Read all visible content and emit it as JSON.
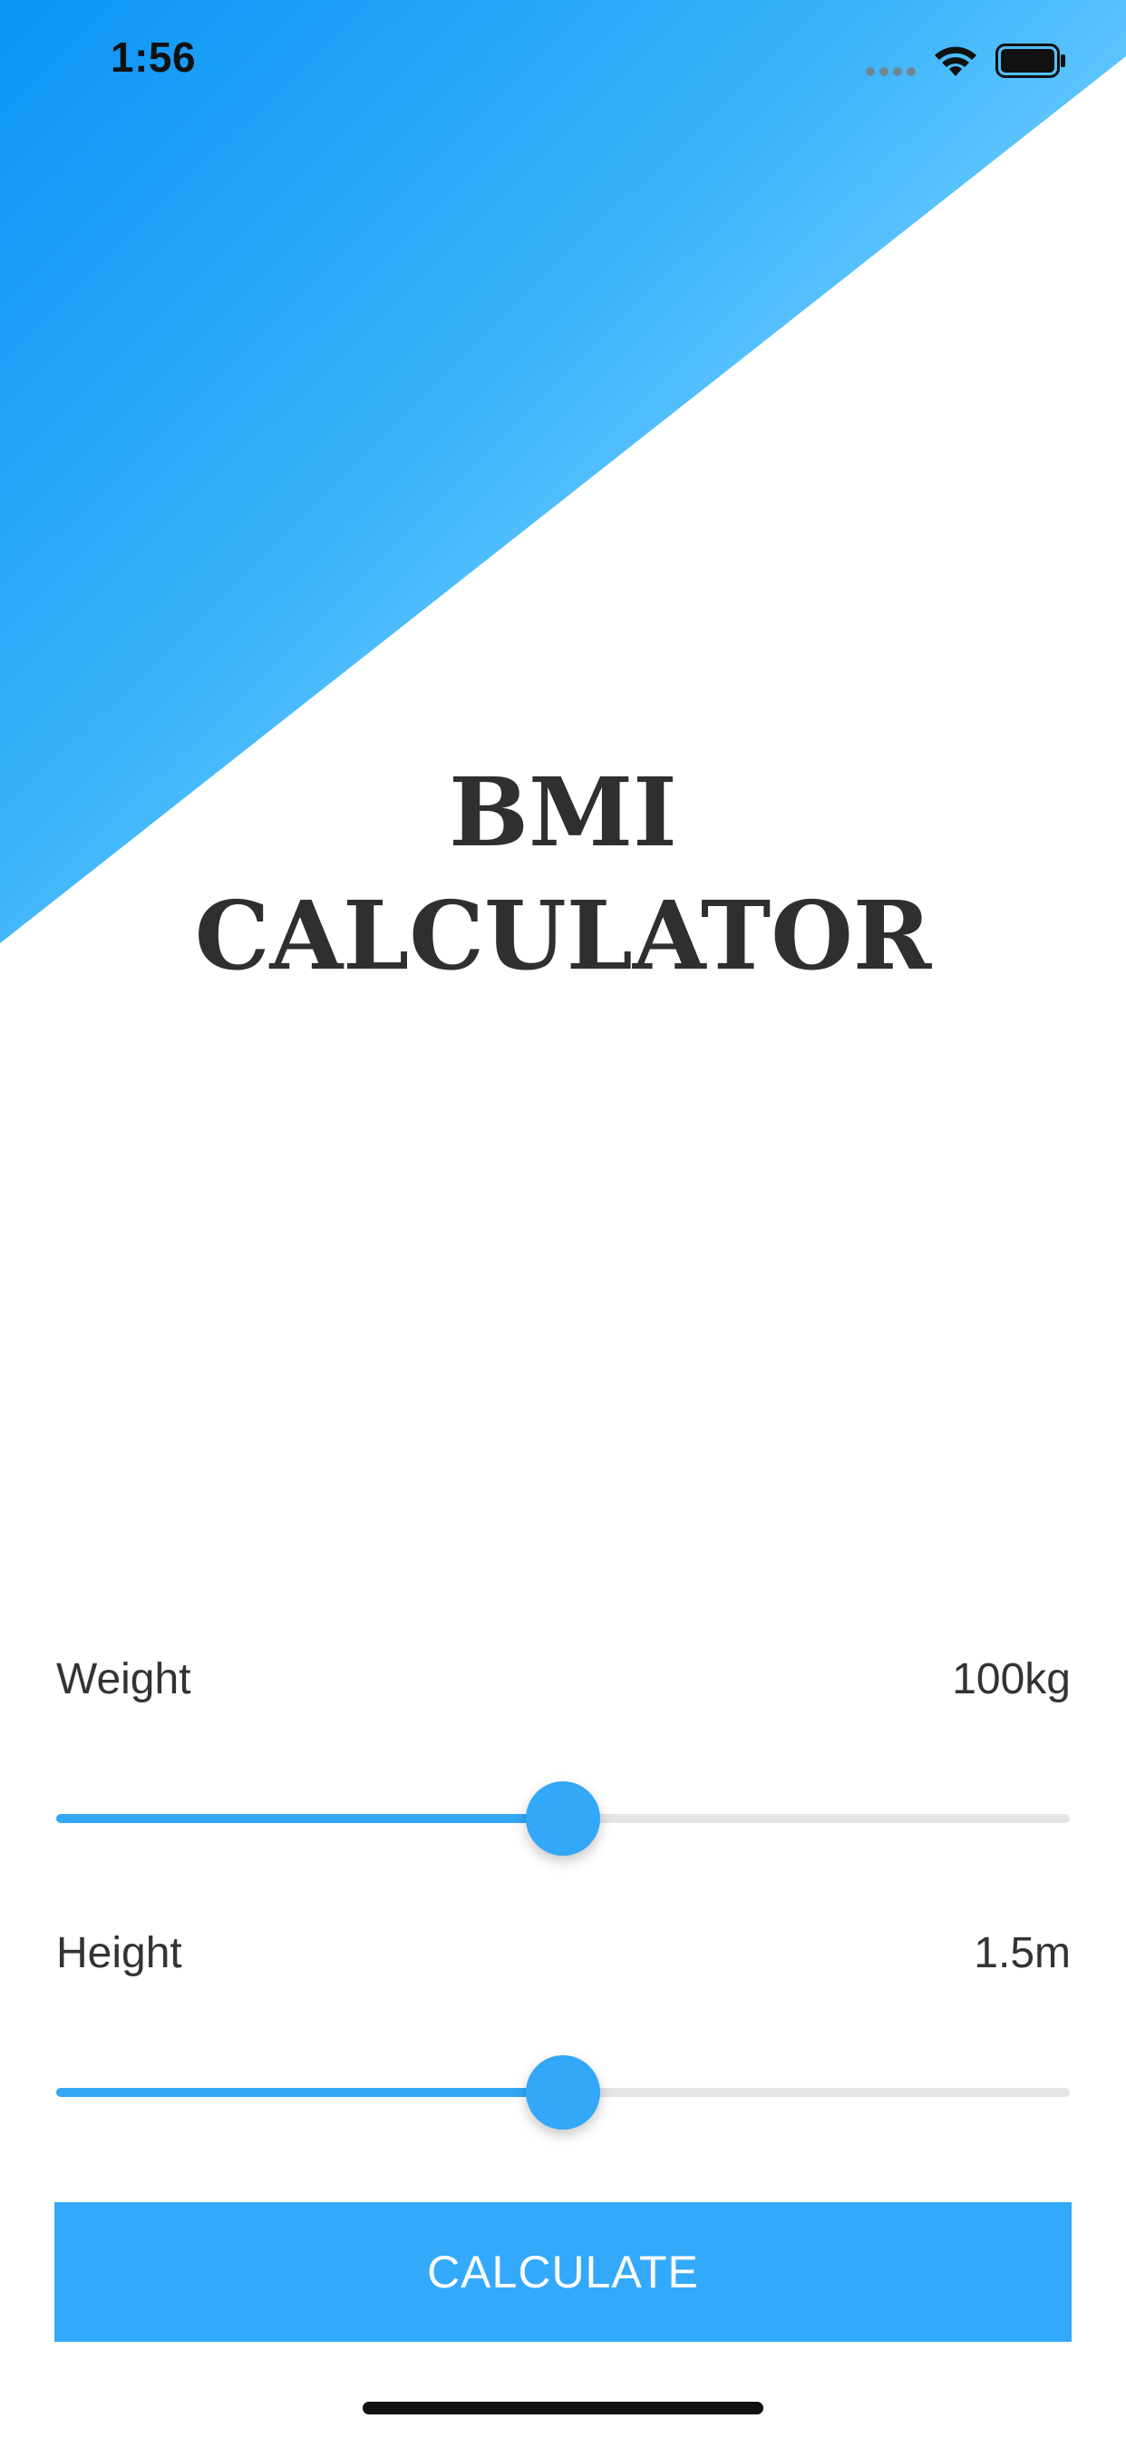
{
  "status_bar": {
    "time": "1:56",
    "wifi_icon": "wifi-icon",
    "battery_icon": "battery-icon",
    "signal_icon": "signal-dots-icon"
  },
  "title": {
    "line1": "BMI",
    "line2": "CALCULATOR"
  },
  "weight": {
    "label": "Weight",
    "value": "100kg",
    "slider_fraction": 0.5
  },
  "height": {
    "label": "Height",
    "value": "1.5m",
    "slider_fraction": 0.5
  },
  "calculate_button": {
    "label": "CALCULATE"
  },
  "colors": {
    "accent": "#33a7f8",
    "gradient_start": "#0b93f5",
    "gradient_end": "#a9ecff",
    "text": "#333333"
  }
}
